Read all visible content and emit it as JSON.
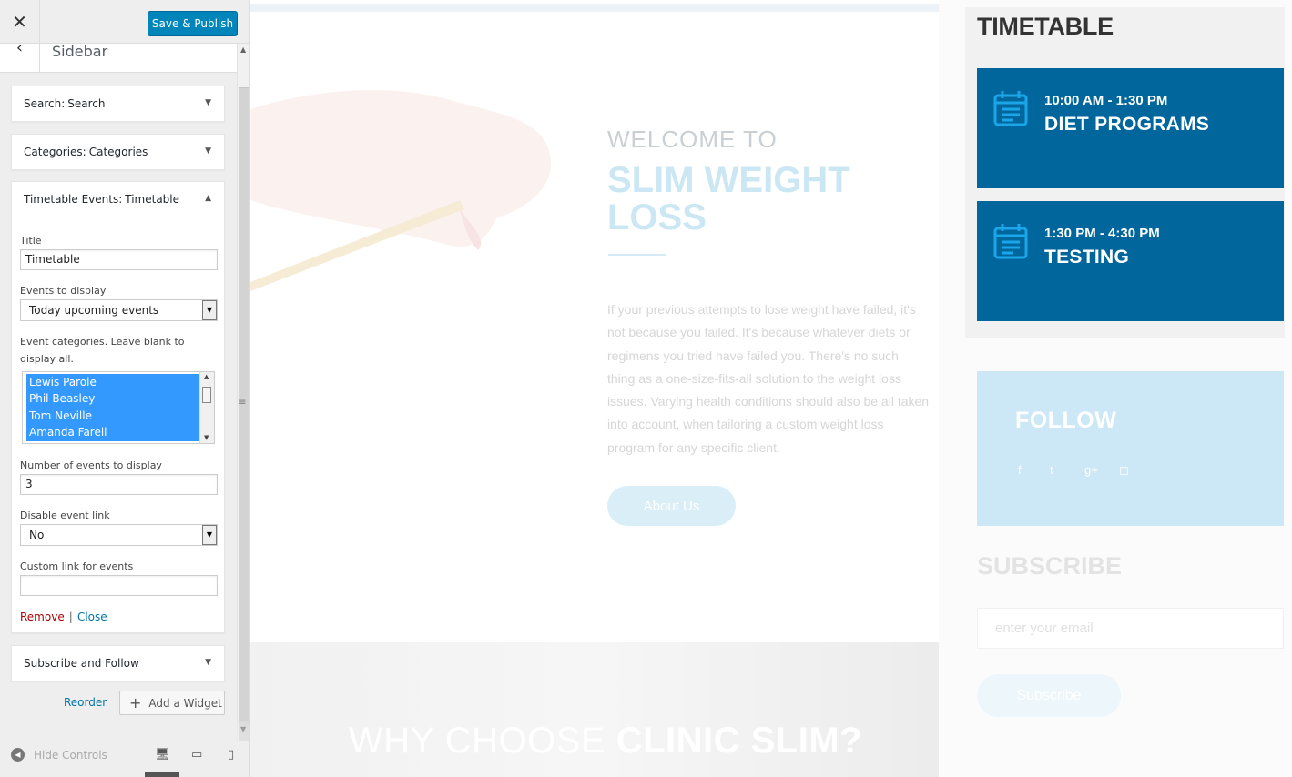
{
  "customizer": {
    "close_glyph": "✕",
    "publish_label": "Save & Publish",
    "back_glyph": "‹",
    "section_title": "Sidebar",
    "widgets": [
      {
        "type": "Search:",
        "title": "Search"
      },
      {
        "type": "Categories:",
        "title": "Categories"
      },
      {
        "type": "Timetable Events:",
        "title": "Timetable"
      },
      {
        "type": "",
        "title": "Subscribe and Follow"
      }
    ],
    "caret_down": "▼",
    "caret_up": "▲",
    "form": {
      "title_label": "Title",
      "title_value": "Timetable",
      "events_label": "Events to display",
      "events_value": "Today upcoming events",
      "categories_label": "Event categories. Leave blank to display all.",
      "categories": [
        "Lewis Parole",
        "Phil Beasley",
        "Tom Neville",
        "Amanda Farell"
      ],
      "number_label": "Number of events to display",
      "number_value": "3",
      "disable_label": "Disable event link",
      "disable_value": "No",
      "custom_label": "Custom link for events",
      "custom_value": "",
      "remove": "Remove",
      "separator": "|",
      "close": "Close"
    },
    "reorder": "Reorder",
    "add_widget": "Add a Widget",
    "hide_controls": "Hide Controls"
  },
  "preview": {
    "welcome": "WELCOME TO",
    "headline": "SLIM WEIGHT LOSS",
    "paragraph": "If your previous attempts to lose weight have failed, it's not because you failed. It's because whatever diets or regimens you tried have failed you. There's no such thing as a one-size-fits-all solution to the weight loss issues. Varying health conditions should also be all taken into account, when tailoring a custom weight loss program for any specific client.",
    "about_button": "About Us",
    "why_light": "WHY CHOOSE ",
    "why_bold": "CLINIC SLIM?",
    "timetable_title": "TIMETABLE",
    "events": [
      {
        "time": "10:00 AM - 1:30 PM",
        "name": "DIET PROGRAMS"
      },
      {
        "time": "1:30 PM - 4:30 PM",
        "name": "TESTING"
      }
    ],
    "follow_title": "FOLLOW",
    "social": [
      "f",
      "t",
      "g+",
      "◻"
    ],
    "subscribe_title": "SUBSCRIBE",
    "subscribe_placeholder": "enter your email",
    "subscribe_button": "Subscribe"
  },
  "colors": {
    "publish": "#0085ba",
    "event_bg": "#01669b",
    "event_icon": "#1aa6e8",
    "follow_bg": "#cce7f5",
    "remove": "#aa0000",
    "link": "#0073aa"
  }
}
